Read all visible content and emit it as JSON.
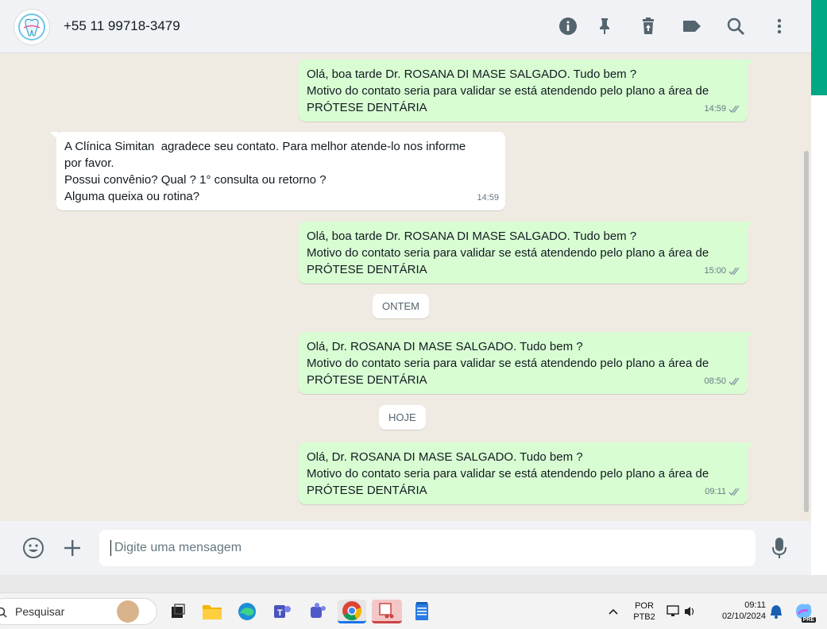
{
  "header": {
    "contact_name": "+55 11 99718-3479",
    "icons": [
      "info-icon",
      "pin-icon",
      "trash-icon",
      "label-icon",
      "search-icon",
      "menu-dots-icon"
    ]
  },
  "messages": [
    {
      "direction": "out",
      "lines": [
        "Olá, boa tarde Dr. ROSANA DI MASE SALGADO. Tudo bem ?",
        "Motivo do contato seria para validar se está atendendo pelo plano a área de",
        "PRÓTESE DENTÁRIA"
      ],
      "time": "14:59"
    },
    {
      "direction": "in",
      "lines": [
        "A Clínica Simitan  agradece seu contato. Para melhor atende-lo nos informe",
        "por favor.",
        "Possui convênio? Qual ? 1° consulta ou retorno ?",
        "Alguma queixa ou rotina?"
      ],
      "time": "14:59"
    },
    {
      "direction": "out",
      "lines": [
        "Olá, boa tarde Dr. ROSANA DI MASE SALGADO. Tudo bem ?",
        "Motivo do contato seria para validar se está atendendo pelo plano a área de",
        "PRÓTESE DENTÁRIA"
      ],
      "time": "15:00"
    },
    {
      "direction": "out",
      "lines": [
        "Olá, Dr. ROSANA DI MASE SALGADO. Tudo bem ?",
        "Motivo do contato seria para validar se está atendendo pelo plano a área de",
        "PRÓTESE DENTÁRIA"
      ],
      "time": "08:50"
    },
    {
      "direction": "out",
      "lines": [
        "Olá, Dr. ROSANA DI MASE SALGADO. Tudo bem ?",
        "Motivo do contato seria para validar se está atendendo pelo plano a área de",
        "PRÓTESE DENTÁRIA"
      ],
      "time": "09:11"
    }
  ],
  "date_separators": {
    "yesterday": "ONTEM",
    "today": "HOJE"
  },
  "composer": {
    "placeholder": "Digite uma mensagem"
  },
  "taskbar": {
    "search_label": "Pesquisar",
    "lang_line1": "POR",
    "lang_line2": "PTB2",
    "clock_time": "09:11",
    "clock_date": "02/10/2024",
    "badge": "PRE"
  },
  "colors": {
    "outgoing": "#d9fdd3",
    "incoming": "#ffffff",
    "accent": "#00a884",
    "background": "#efeae2"
  }
}
